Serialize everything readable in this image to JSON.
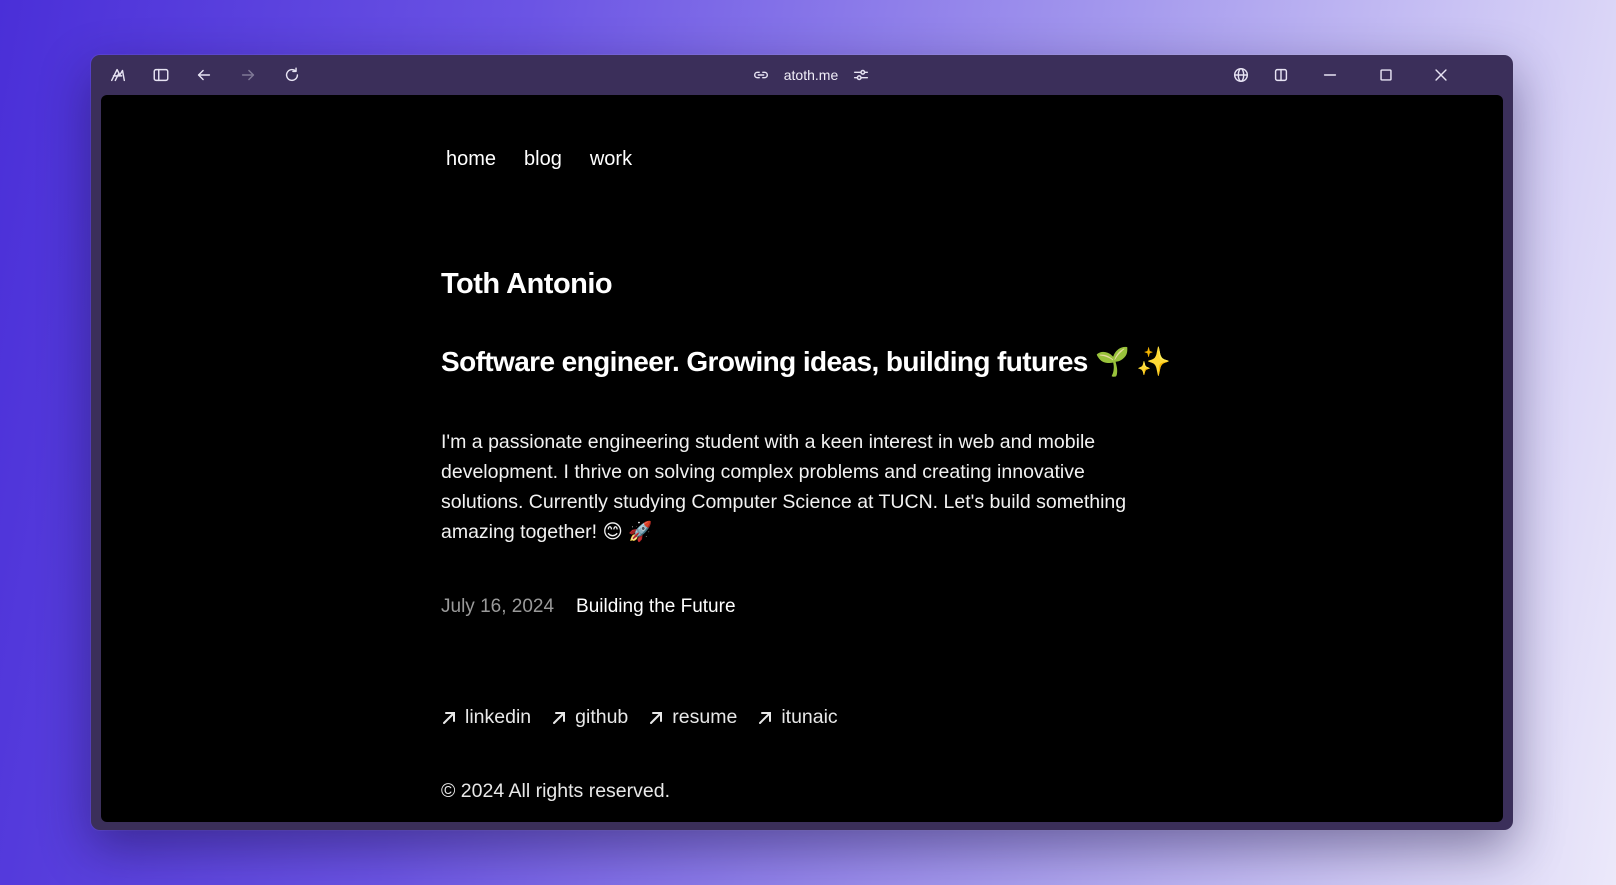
{
  "browser": {
    "url": "atoth.me"
  },
  "nav": {
    "items": [
      "home",
      "blog",
      "work"
    ]
  },
  "hero": {
    "name": "Toth Antonio",
    "tagline": "Software engineer. Growing ideas, building futures 🌱 ✨",
    "bio": "I'm a passionate engineering student with a keen interest in web and mobile development. I thrive on solving complex problems and creating innovative solutions. Currently studying Computer Science at TUCN. Let's build something amazing together! 😊 🚀"
  },
  "post": {
    "date": "July 16, 2024",
    "title": "Building the Future"
  },
  "links": [
    "linkedin",
    "github",
    "resume",
    "itunaic"
  ],
  "footer": {
    "copyright": "© 2024 All rights reserved."
  }
}
